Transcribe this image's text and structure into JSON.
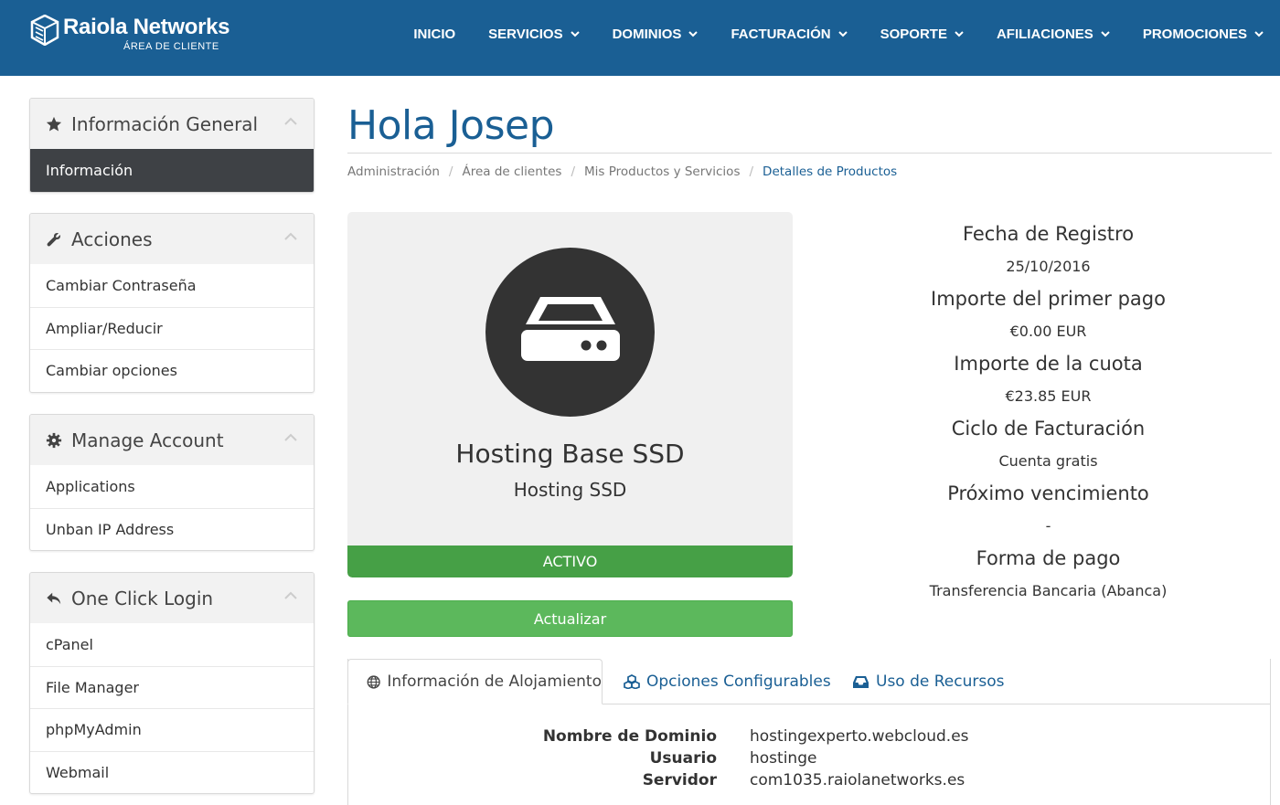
{
  "brand": {
    "name": "Raiola Networks",
    "subtitle": "ÁREA DE CLIENTE"
  },
  "nav": [
    {
      "label": "INICIO",
      "dropdown": false
    },
    {
      "label": "SERVICIOS",
      "dropdown": true
    },
    {
      "label": "DOMINIOS",
      "dropdown": true
    },
    {
      "label": "FACTURACIÓN",
      "dropdown": true
    },
    {
      "label": "SOPORTE",
      "dropdown": true
    },
    {
      "label": "AFILIACIONES",
      "dropdown": true
    },
    {
      "label": "PROMOCIONES",
      "dropdown": true
    }
  ],
  "sidebar": {
    "info": {
      "title": "Información General",
      "items": [
        "Información"
      ]
    },
    "actions": {
      "title": "Acciones",
      "items": [
        "Cambiar Contraseña",
        "Ampliar/Reducir",
        "Cambiar opciones"
      ]
    },
    "manage": {
      "title": "Manage Account",
      "items": [
        "Applications",
        "Unban IP Address"
      ]
    },
    "login": {
      "title": "One Click Login",
      "items": [
        "cPanel",
        "File Manager",
        "phpMyAdmin",
        "Webmail"
      ]
    }
  },
  "page": {
    "title": "Hola Josep"
  },
  "breadcrumb": [
    "Administración",
    "Área de clientes",
    "Mis Productos y Servicios",
    "Detalles de Productos"
  ],
  "product": {
    "name": "Hosting Base SSD",
    "group": "Hosting SSD",
    "status": "ACTIVO",
    "upgrade_label": "Actualizar"
  },
  "details": [
    {
      "label": "Fecha de Registro",
      "value": "25/10/2016"
    },
    {
      "label": "Importe del primer pago",
      "value": "€0.00 EUR"
    },
    {
      "label": "Importe de la cuota",
      "value": "€23.85 EUR"
    },
    {
      "label": "Ciclo de Facturación",
      "value": "Cuenta gratis"
    },
    {
      "label": "Próximo vencimiento",
      "value": "-"
    },
    {
      "label": "Forma de pago",
      "value": "Transferencia Bancaria (Abanca)"
    }
  ],
  "tabs": [
    {
      "label": "Información de Alojamiento",
      "icon": "globe-icon"
    },
    {
      "label": "Opciones Configurables",
      "icon": "cubes-icon"
    },
    {
      "label": "Uso de Recursos",
      "icon": "inbox-icon"
    }
  ],
  "hosting_info": [
    {
      "key": "Nombre de Dominio",
      "value": "hostingexperto.webcloud.es"
    },
    {
      "key": "Usuario",
      "value": "hostinge"
    },
    {
      "key": "Servidor",
      "value": "com1035.raiolanetworks.es"
    }
  ],
  "colors": {
    "header": "#1a5f94",
    "active": "#46a046",
    "button": "#5cb85c",
    "sidebar_active": "#3e4145"
  }
}
